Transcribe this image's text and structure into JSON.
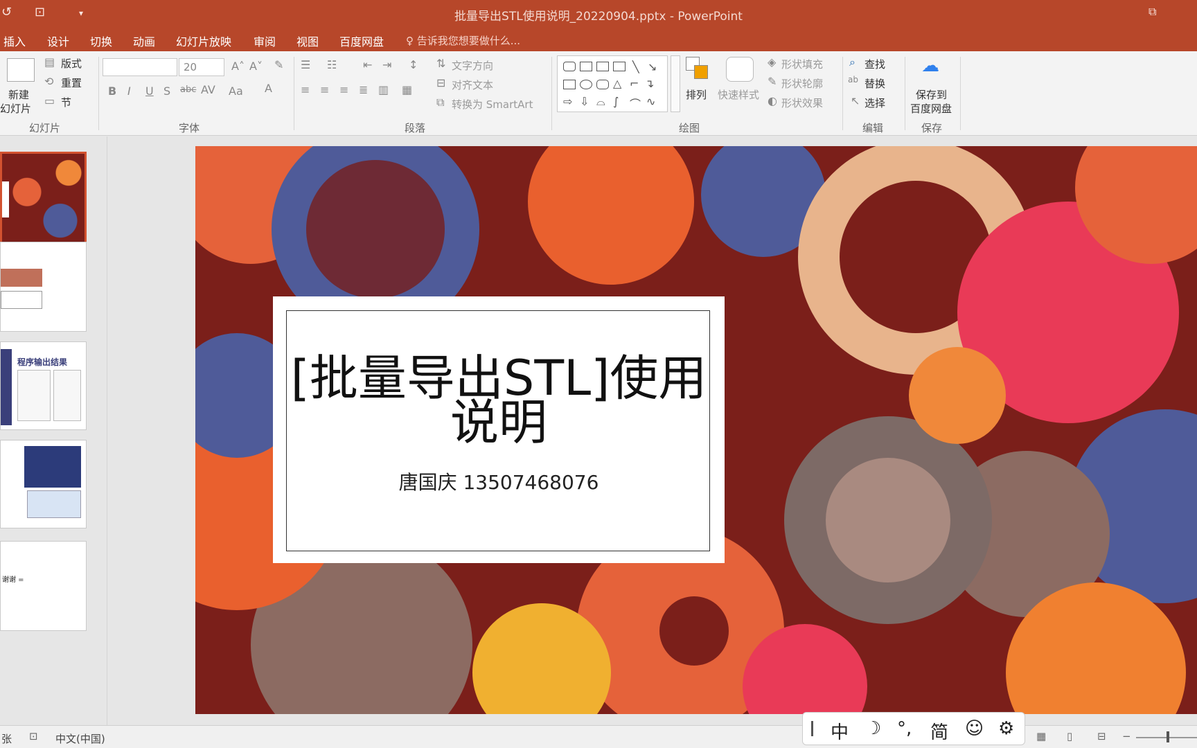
{
  "titlebar": {
    "title": "批量导出STL使用说明_20220904.pptx - PowerPoint",
    "quick_access": [
      "↺",
      "⊡",
      "▾"
    ],
    "restore": "⧉"
  },
  "tabs": [
    "插入",
    "设计",
    "切换",
    "动画",
    "幻灯片放映",
    "审阅",
    "视图",
    "百度网盘"
  ],
  "tell_me": "告诉我您想要做什么...",
  "ribbon": {
    "slides": {
      "new_slide": [
        "新建",
        "幻灯片"
      ],
      "layout": "版式",
      "reset": "重置",
      "section": "节",
      "label": "幻灯片"
    },
    "font": {
      "size": "20",
      "label": "字体"
    },
    "paragraph": {
      "text_direction": "文字方向",
      "align_text": "对齐文本",
      "smartart": "转换为 SmartArt",
      "label": "段落"
    },
    "drawing": {
      "arrange": "排列",
      "quick_styles": "快速样式",
      "fill": "形状填充",
      "outline": "形状轮廓",
      "effects": "形状效果",
      "label": "绘图"
    },
    "editing": {
      "find": "查找",
      "replace": "替换",
      "select": "选择",
      "label": "编辑"
    },
    "save": {
      "line1": "保存到",
      "line2": "百度网盘",
      "label": "保存"
    }
  },
  "slide": {
    "title_line1": "[批量导出STL]使用",
    "title_line2": "说明",
    "subtitle": "唐国庆 13507468076"
  },
  "thumbs": {
    "t3_title": "程序输出结果",
    "t5_text": "谢谢 ="
  },
  "status": {
    "left": "张",
    "lang": "中文(中国)"
  },
  "ime": [
    "中",
    "☽",
    "°,",
    "简",
    "☺",
    "⚙"
  ],
  "colors": {
    "accent": "#b7472a",
    "slide_bg": "#7b1f1a"
  }
}
